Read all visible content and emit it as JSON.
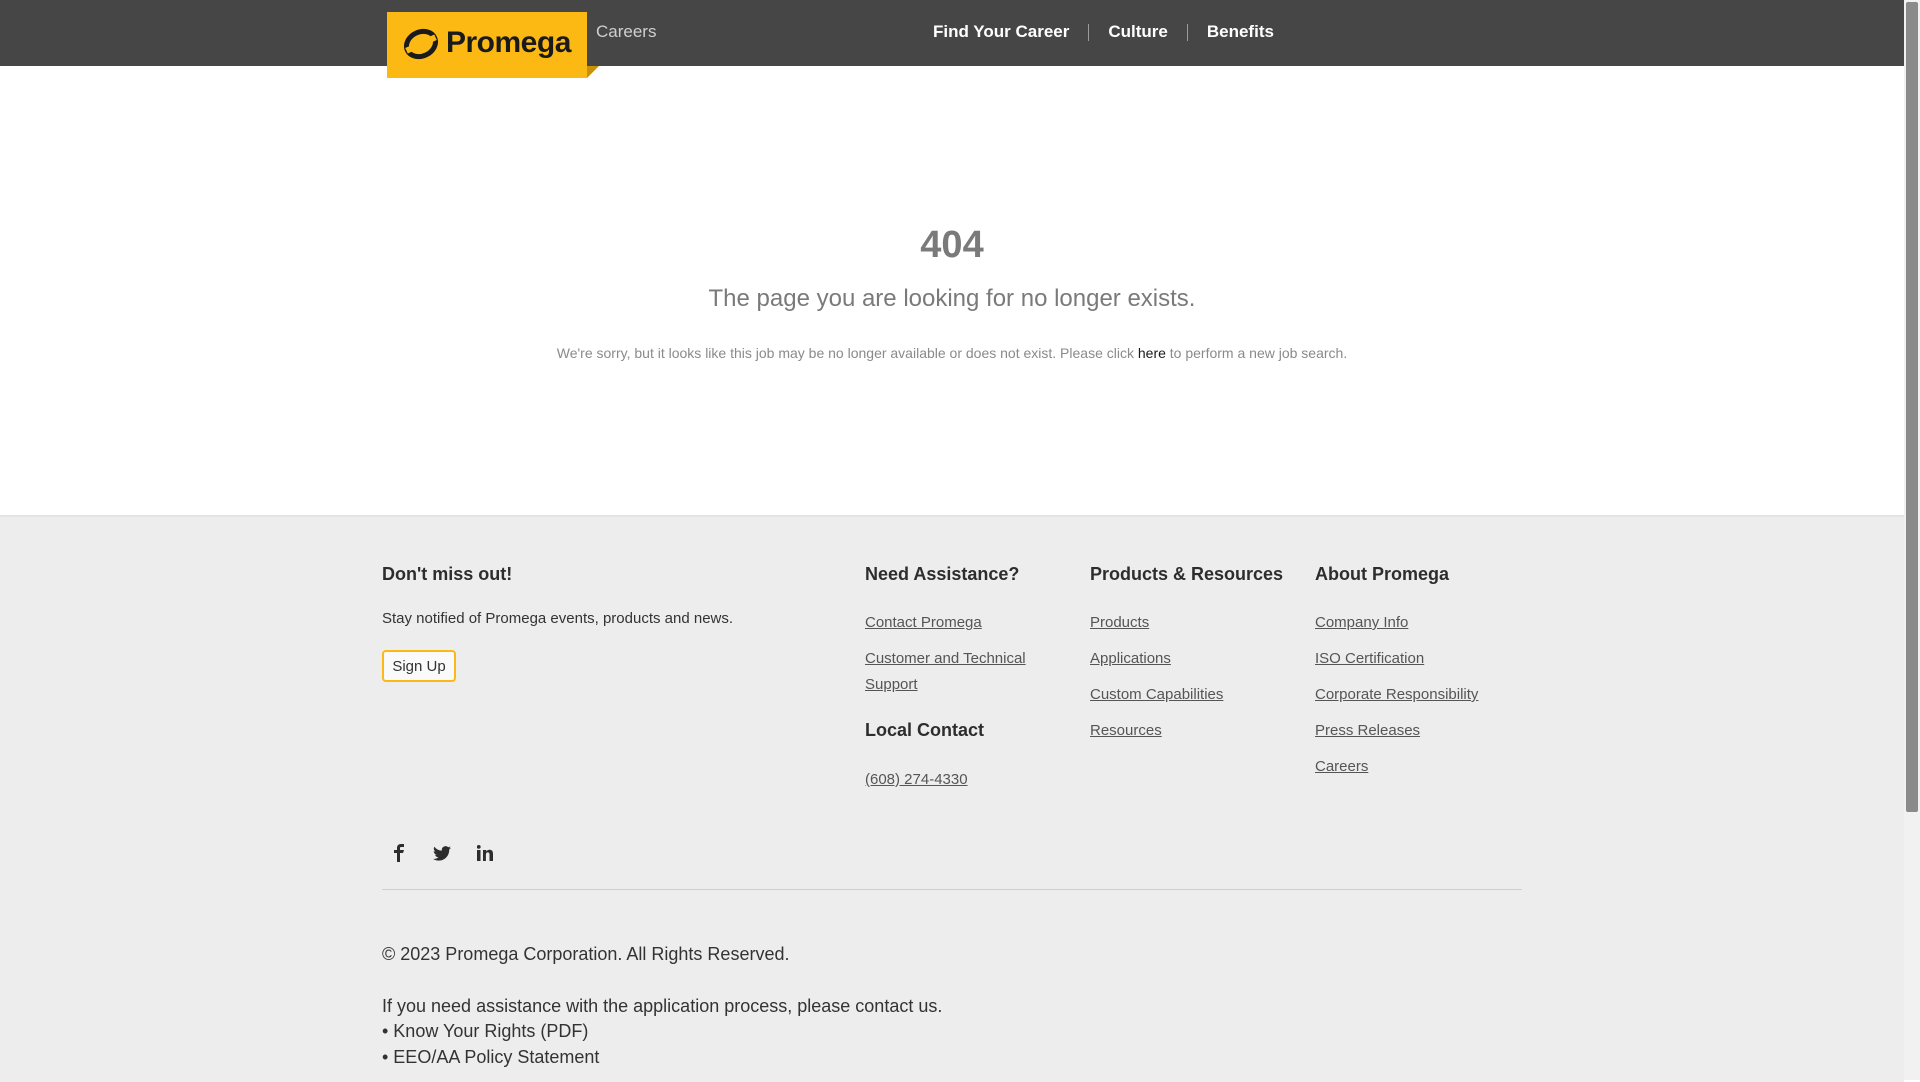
{
  "header": {
    "logo_text": "Promega",
    "section_label": "Careers",
    "nav": [
      "Find Your Career",
      "Culture",
      "Benefits"
    ]
  },
  "error": {
    "code": "404",
    "title": "The page you are looking for no longer exists.",
    "message_before": "We're sorry, but it looks like this job may be no longer available or does not exist. Please click",
    "link_text": "here",
    "message_after": "to perform a new job search."
  },
  "footer": {
    "newsletter": {
      "heading": "Don't miss out!",
      "text": "Stay notified of Promega events, products and news.",
      "button": "Sign Up"
    },
    "assistance": {
      "heading": "Need Assistance?",
      "links": [
        "Contact Promega",
        "Customer and Technical",
        "Support"
      ]
    },
    "local_contact": {
      "heading": "Local Contact",
      "phone": "(608) 274-4330"
    },
    "products": {
      "heading": "Products & Resources",
      "links": [
        "Products",
        "Applications",
        "Custom Capabilities",
        "Resources"
      ]
    },
    "about": {
      "heading": "About Promega",
      "links": [
        "Company Info",
        "ISO Certification",
        "Corporate Responsibility",
        "Press Releases",
        "Careers"
      ]
    },
    "social_icons": [
      "facebook-icon",
      "twitter-icon",
      "linkedin-icon"
    ],
    "copyright": "© 2023 Promega Corporation. All Rights Reserved.",
    "assist_before": "If you need assistance with the application process, please",
    "assist_link": "contact us.",
    "bullets": [
      "• Know Your Rights (PDF)",
      "• EEO/AA Policy Statement"
    ]
  },
  "colors": {
    "header_bg": "#464646",
    "brand_yellow": "#fdb913",
    "footer_bg": "#ededed"
  }
}
